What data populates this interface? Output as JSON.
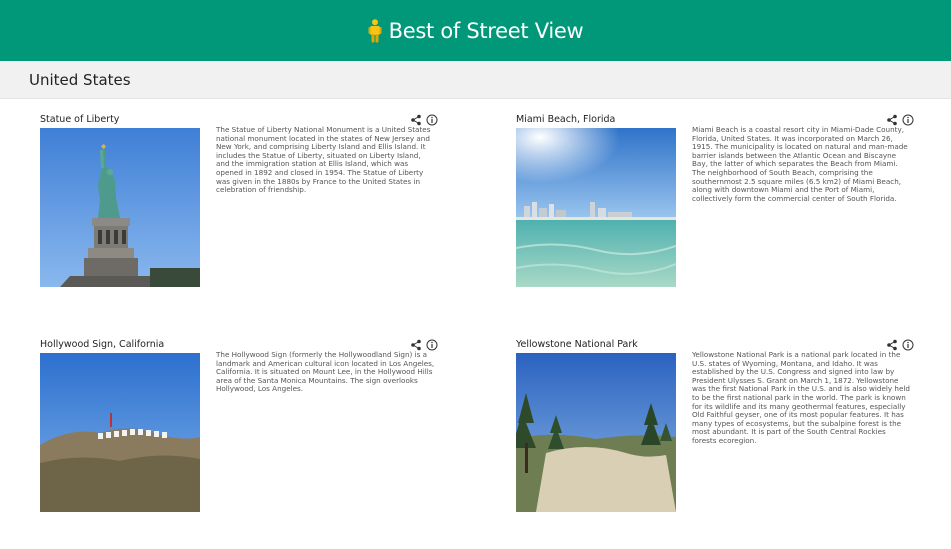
{
  "app": {
    "title": "Best of Street View",
    "logo_icon": "pegman-icon",
    "brand_color": "#009879"
  },
  "section": {
    "title": "United States"
  },
  "cards": [
    {
      "title": "Statue of Liberty",
      "share_icon": "share-icon",
      "info_icon": "info-icon",
      "description": "The Statue of Liberty National Monument is a United States national monument located in the states of New Jersey and New York, and comprising Liberty Island and Ellis Island. It includes the Statue of Liberty, situated on Liberty Island, and the immigration station at Ellis Island, which was opened in 1892 and closed in 1954. The Statue of Liberty was given in the 1880s by France to the United States in celebration of friendship."
    },
    {
      "title": "Miami Beach, Florida",
      "share_icon": "share-icon",
      "info_icon": "info-icon",
      "description": "Miami Beach is a coastal resort city in Miami-Dade County, Florida, United States. It was incorporated on March 26, 1915. The municipality is located on natural and man-made barrier islands between the Atlantic Ocean and Biscayne Bay, the latter of which separates the Beach from Miami. The neighborhood of South Beach, comprising the southernmost 2.5 square miles (6.5 km2) of Miami Beach, along with downtown Miami and the Port of Miami, collectively form the commercial center of South Florida."
    },
    {
      "title": "Hollywood Sign, California",
      "share_icon": "share-icon",
      "info_icon": "info-icon",
      "description": "The Hollywood Sign (formerly the Hollywoodland Sign) is a landmark and American cultural icon located in Los Angeles, California. It is situated on Mount Lee, in the Hollywood Hills area of the Santa Monica Mountains. The sign overlooks Hollywood, Los Angeles."
    },
    {
      "title": "Yellowstone National Park",
      "share_icon": "share-icon",
      "info_icon": "info-icon",
      "description": "Yellowstone National Park is a national park located in the U.S. states of Wyoming, Montana, and Idaho. It was established by the U.S. Congress and signed into law by President Ulysses S. Grant on March 1, 1872. Yellowstone was the first National Park in the U.S. and is also widely held to be the first national park in the world. The park is known for its wildlife and its many geothermal features, especially Old Faithful geyser, one of its most popular features. It has many types of ecosystems, but the subalpine forest is the most abundant. It is part of the South Central Rockies forests ecoregion."
    }
  ]
}
